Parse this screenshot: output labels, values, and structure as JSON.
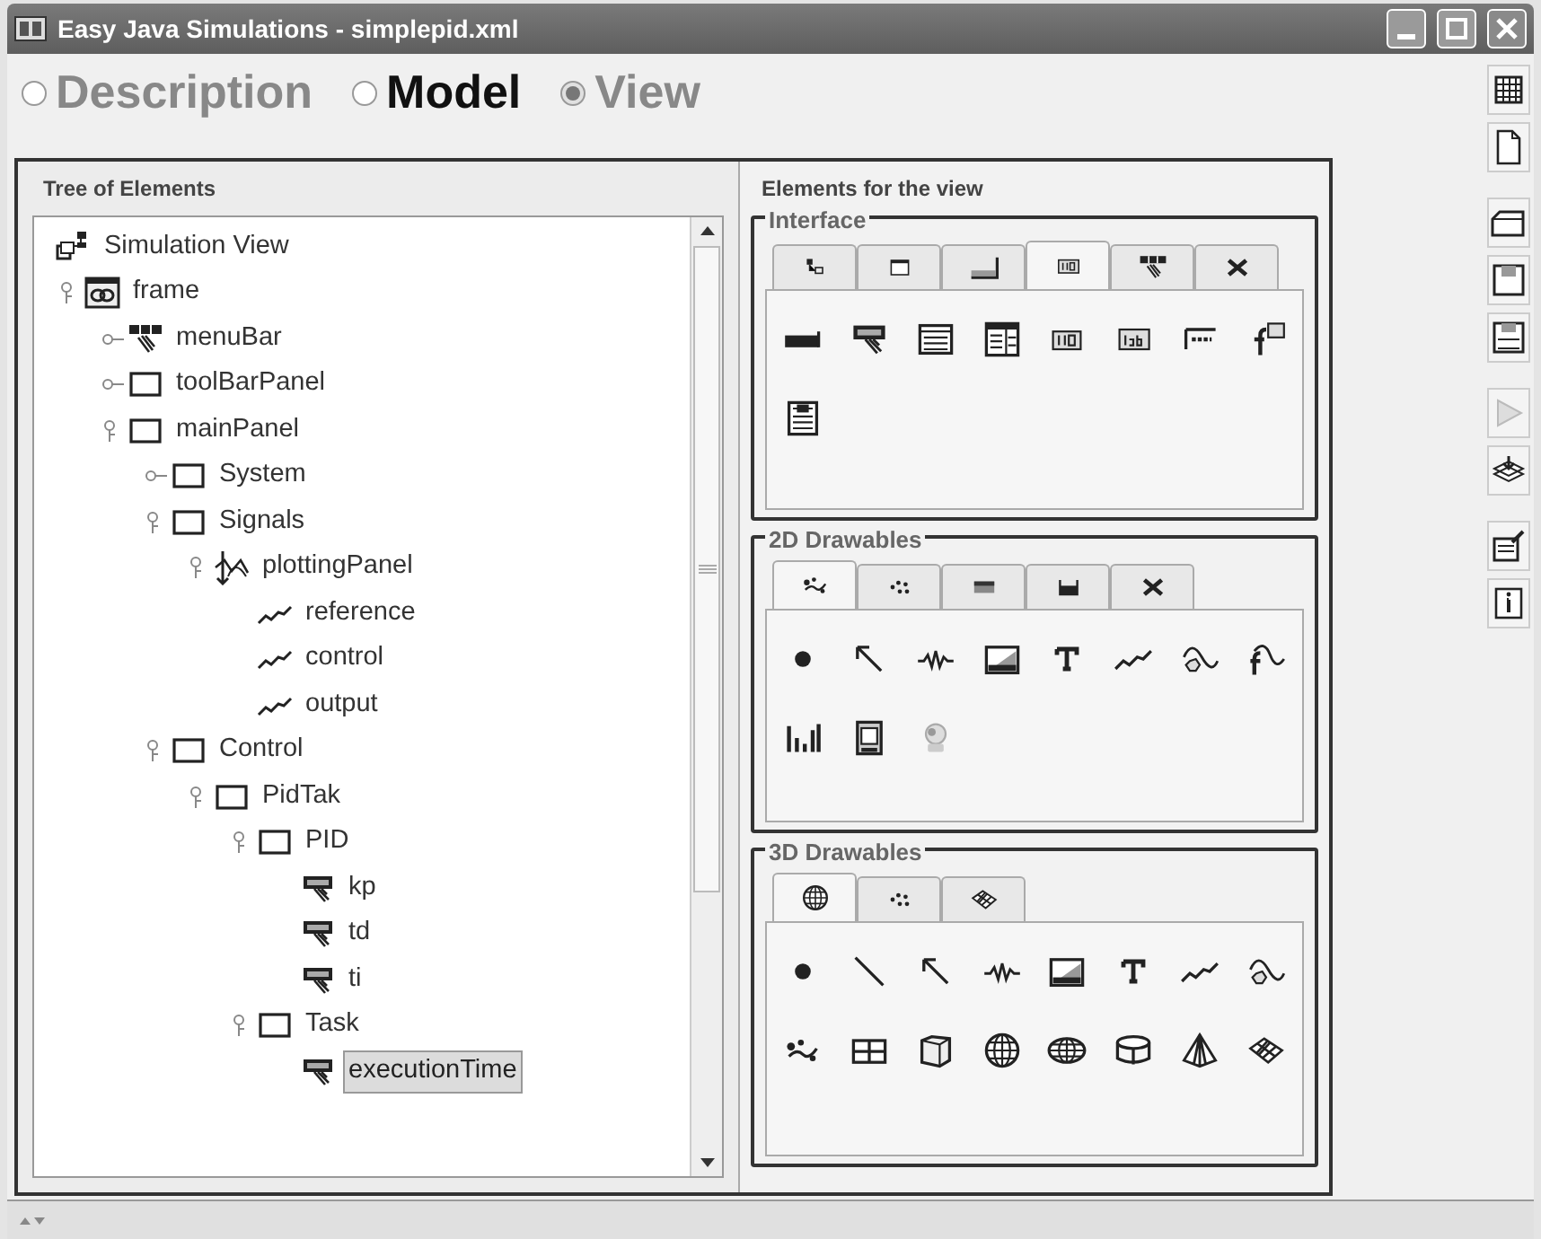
{
  "window": {
    "title": "Easy Java Simulations - simplepid.xml"
  },
  "modes": [
    {
      "label": "Description",
      "selected": false,
      "highlighted": false
    },
    {
      "label": "Model",
      "selected": false,
      "highlighted": true
    },
    {
      "label": "View",
      "selected": true,
      "highlighted": false
    }
  ],
  "tree": {
    "title": "Tree of Elements",
    "root": {
      "label": "Simulation View",
      "kind": "view",
      "selected": false,
      "children": [
        {
          "label": "frame",
          "kind": "frame",
          "expanded": true,
          "selected": false,
          "children": [
            {
              "label": "menuBar",
              "kind": "menubar",
              "expanded": false,
              "selected": false
            },
            {
              "label": "toolBarPanel",
              "kind": "panel",
              "expanded": false,
              "selected": false
            },
            {
              "label": "mainPanel",
              "kind": "panel",
              "expanded": true,
              "selected": false,
              "children": [
                {
                  "label": "System",
                  "kind": "panel",
                  "expanded": false,
                  "selected": false
                },
                {
                  "label": "Signals",
                  "kind": "panel",
                  "expanded": true,
                  "selected": false,
                  "children": [
                    {
                      "label": "plottingPanel",
                      "kind": "plot",
                      "expanded": true,
                      "selected": false,
                      "children": [
                        {
                          "label": "reference",
                          "kind": "trace",
                          "selected": false
                        },
                        {
                          "label": "control",
                          "kind": "trace",
                          "selected": false
                        },
                        {
                          "label": "output",
                          "kind": "trace",
                          "selected": false
                        }
                      ]
                    }
                  ]
                },
                {
                  "label": "Control",
                  "kind": "panel",
                  "expanded": true,
                  "selected": false,
                  "children": [
                    {
                      "label": "PidTak",
                      "kind": "panel",
                      "expanded": true,
                      "selected": false,
                      "children": [
                        {
                          "label": "PID",
                          "kind": "panel",
                          "expanded": true,
                          "selected": false,
                          "children": [
                            {
                              "label": "kp",
                              "kind": "slider",
                              "selected": false
                            },
                            {
                              "label": "td",
                              "kind": "slider",
                              "selected": false
                            },
                            {
                              "label": "ti",
                              "kind": "slider",
                              "selected": false
                            }
                          ]
                        },
                        {
                          "label": "Task",
                          "kind": "panel",
                          "expanded": true,
                          "selected": false,
                          "children": [
                            {
                              "label": "executionTime",
                              "kind": "slider",
                              "selected": true
                            }
                          ]
                        }
                      ]
                    }
                  ]
                }
              ]
            }
          ]
        }
      ]
    }
  },
  "palette": {
    "title": "Elements for the view",
    "groups": [
      {
        "title": "Interface",
        "tabs": [
          {
            "kind": "tree",
            "selected": false
          },
          {
            "kind": "window",
            "selected": false
          },
          {
            "kind": "bar",
            "selected": false
          },
          {
            "kind": "field",
            "selected": true
          },
          {
            "kind": "menubar",
            "selected": false
          },
          {
            "kind": "cross",
            "selected": false
          }
        ],
        "items": [
          {
            "kind": "button"
          },
          {
            "kind": "slider"
          },
          {
            "kind": "list"
          },
          {
            "kind": "table"
          },
          {
            "kind": "field"
          },
          {
            "kind": "textfield"
          },
          {
            "kind": "password"
          },
          {
            "kind": "formula"
          },
          {
            "kind": "textarea"
          }
        ]
      },
      {
        "title": "2D Drawables",
        "tabs": [
          {
            "kind": "scatter",
            "selected": true
          },
          {
            "kind": "dots",
            "selected": false
          },
          {
            "kind": "gradient",
            "selected": false
          },
          {
            "kind": "tank",
            "selected": false
          },
          {
            "kind": "cross",
            "selected": false
          }
        ],
        "items": [
          {
            "kind": "dot"
          },
          {
            "kind": "arrow"
          },
          {
            "kind": "spring"
          },
          {
            "kind": "image"
          },
          {
            "kind": "text"
          },
          {
            "kind": "trace"
          },
          {
            "kind": "polygon"
          },
          {
            "kind": "function"
          },
          {
            "kind": "bars"
          },
          {
            "kind": "document"
          },
          {
            "kind": "camera"
          }
        ]
      },
      {
        "title": "3D Drawables",
        "tabs": [
          {
            "kind": "sphere",
            "selected": true
          },
          {
            "kind": "dots",
            "selected": false
          },
          {
            "kind": "surface",
            "selected": false
          }
        ],
        "items": [
          {
            "kind": "dot"
          },
          {
            "kind": "segment"
          },
          {
            "kind": "arrow"
          },
          {
            "kind": "spring"
          },
          {
            "kind": "image"
          },
          {
            "kind": "text"
          },
          {
            "kind": "trace"
          },
          {
            "kind": "polygon"
          },
          {
            "kind": "scatter"
          },
          {
            "kind": "grid"
          },
          {
            "kind": "cube"
          },
          {
            "kind": "sphere"
          },
          {
            "kind": "ellipsoid"
          },
          {
            "kind": "cylinder"
          },
          {
            "kind": "cone"
          },
          {
            "kind": "surface"
          }
        ]
      }
    ]
  }
}
